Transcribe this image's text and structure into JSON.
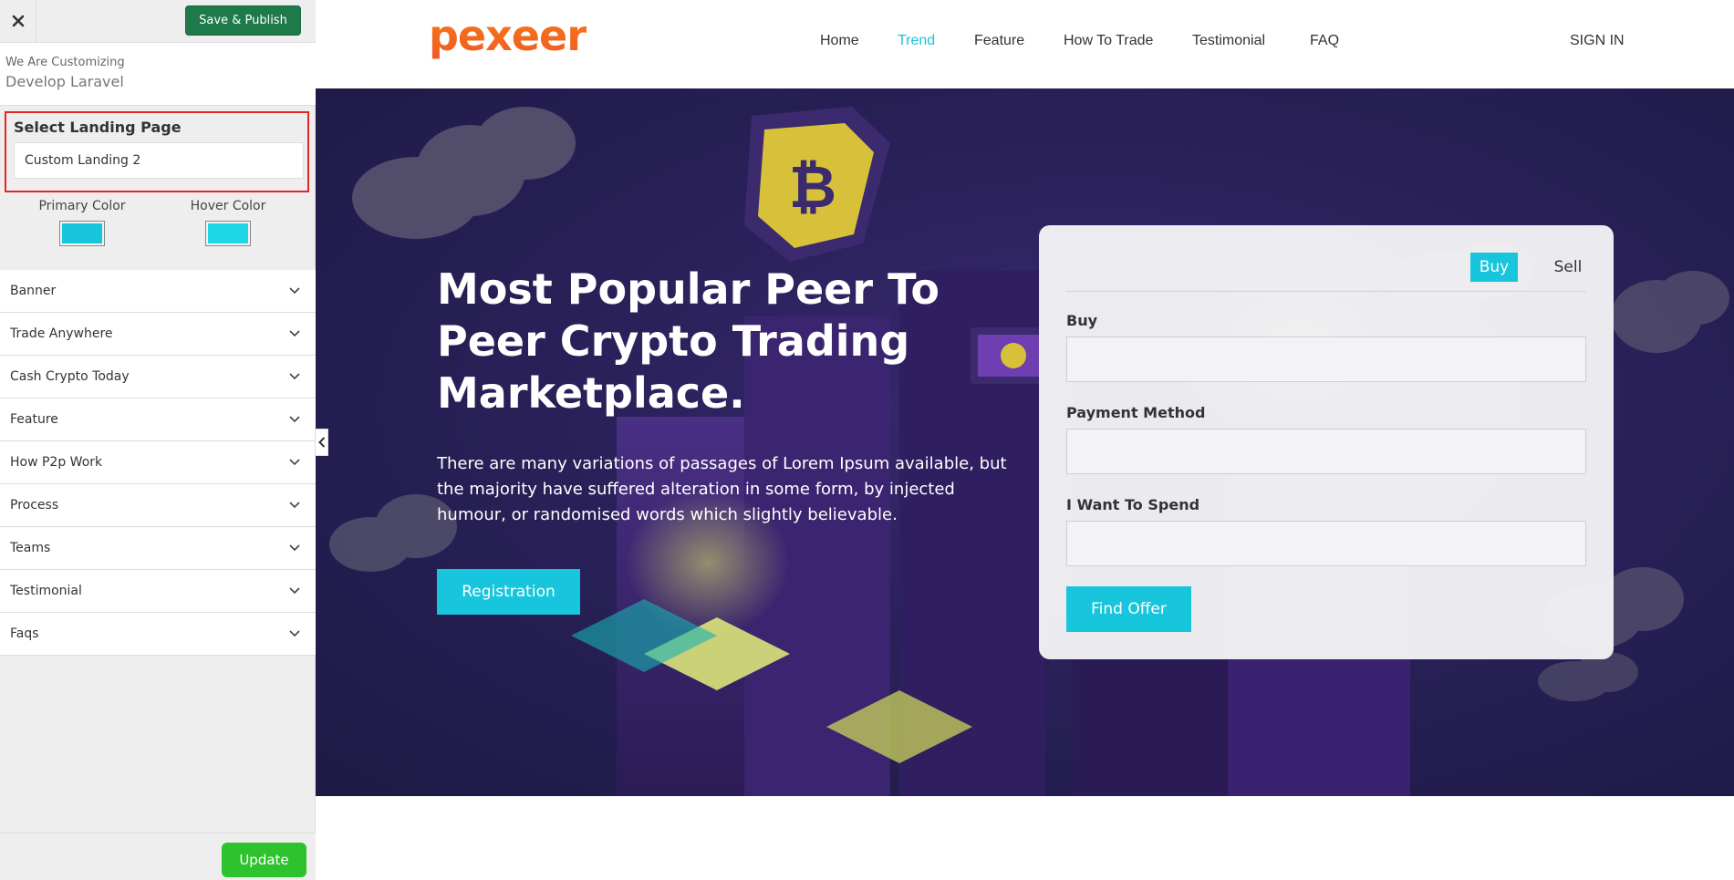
{
  "sidebar": {
    "close_icon": "close-icon",
    "save_label": "Save & Publish",
    "customizing_label": "We Are Customizing",
    "site_name": "Develop Laravel",
    "landing_label": "Select Landing Page",
    "landing_value": "Custom Landing 2",
    "primary_color_label": "Primary Color",
    "hover_color_label": "Hover Color",
    "primary_color": "#17c5dc",
    "hover_color": "#1fd6e6",
    "sections": [
      {
        "label": "Banner"
      },
      {
        "label": "Trade Anywhere"
      },
      {
        "label": "Cash Crypto Today"
      },
      {
        "label": "Feature"
      },
      {
        "label": "How P2p Work"
      },
      {
        "label": "Process"
      },
      {
        "label": "Teams"
      },
      {
        "label": "Testimonial"
      },
      {
        "label": "Faqs"
      }
    ],
    "update_label": "Update",
    "save_color": "#1f7a4a",
    "update_color": "#2fc22f"
  },
  "header": {
    "logo": "pexeer",
    "nav": [
      {
        "label": "Home"
      },
      {
        "label": "Trend"
      },
      {
        "label": "Feature"
      },
      {
        "label": "How To Trade"
      },
      {
        "label": "Testimonial"
      },
      {
        "label": "FAQ"
      }
    ],
    "active_nav": "Trend",
    "sign_in": "SIGN IN"
  },
  "hero": {
    "title": "Most Popular Peer To Peer Crypto Trading Marketplace.",
    "text": "There are many variations of passages of Lorem Ipsum available, but the majority have suffered alteration in some form, by injected humour, or randomised words which slightly believable.",
    "registration_label": "Registration"
  },
  "trade_card": {
    "tab_buy": "Buy",
    "tab_sell": "Sell",
    "buy_label": "Buy",
    "payment_label": "Payment Method",
    "spend_label": "I Want To Spend",
    "find_offer": "Find Offer"
  },
  "colors": {
    "accent": "#17c5dc",
    "hero_bg": "#2a215a",
    "active_nav": "#17c5dc"
  }
}
